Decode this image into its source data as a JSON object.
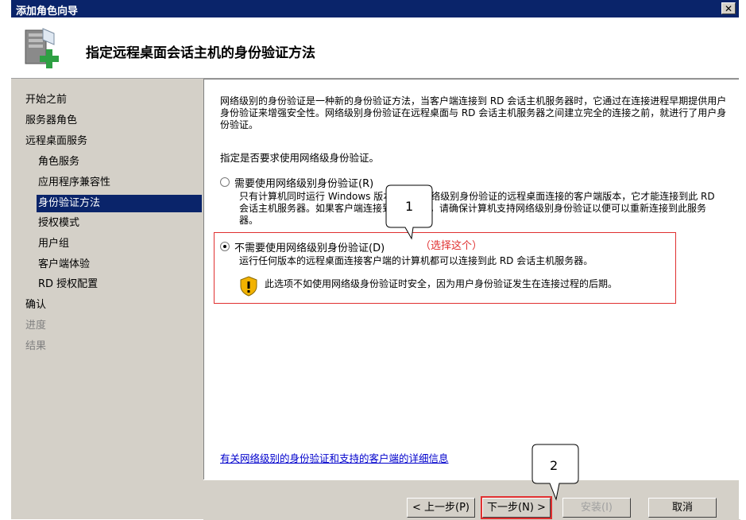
{
  "window": {
    "title": "添加角色向导",
    "close_glyph": "✕"
  },
  "header": {
    "title": "指定远程桌面会话主机的身份验证方法",
    "icon": "server-add-icon"
  },
  "nav": {
    "items": [
      {
        "label": "开始之前",
        "level": 0,
        "state": "normal"
      },
      {
        "label": "服务器角色",
        "level": 0,
        "state": "normal"
      },
      {
        "label": "远程桌面服务",
        "level": 0,
        "state": "normal"
      },
      {
        "label": "角色服务",
        "level": 1,
        "state": "normal"
      },
      {
        "label": "应用程序兼容性",
        "level": 1,
        "state": "normal"
      },
      {
        "label": "身份验证方法",
        "level": 1,
        "state": "active"
      },
      {
        "label": "授权模式",
        "level": 1,
        "state": "normal"
      },
      {
        "label": "用户组",
        "level": 1,
        "state": "normal"
      },
      {
        "label": "客户端体验",
        "level": 1,
        "state": "normal"
      },
      {
        "label": "RD 授权配置",
        "level": 1,
        "state": "normal"
      },
      {
        "label": "确认",
        "level": 0,
        "state": "normal"
      },
      {
        "label": "进度",
        "level": 0,
        "state": "disabled"
      },
      {
        "label": "结果",
        "level": 0,
        "state": "disabled"
      }
    ]
  },
  "content": {
    "description": "网络级别的身份验证是一种新的身份验证方法，当客户端连接到 RD 会话主机服务器时，它通过在连接进程早期提供用户身份验证来增强安全性。网络级别身份验证在远程桌面与 RD 会话主机服务器之间建立完全的连接之前，就进行了用户身份验证。",
    "prompt": "指定是否要求使用网络级身份验证。",
    "option_require": {
      "label": "需要使用网络级别身份验证(R)",
      "description": "只有计算机同时运行 Windows 版本和支持网络级别身份验证的远程桌面连接的客户端版本，它才能连接到此 RD 会话主机服务器。如果客户端连接到此服务器，请确保计算机支持网络级别身份验证以便可以重新连接到此服务器。",
      "selected": false
    },
    "option_no_require": {
      "label": "不需要使用网络级别身份验证(D)",
      "description": "运行任何版本的远程桌面连接客户端的计算机都可以连接到此 RD 会话主机服务器。",
      "warning": "此选项不如使用网络级身份验证时安全，因为用户身份验证发生在连接过程的后期。",
      "selected": true
    },
    "annotation": "（选择这个）",
    "link": "有关网络级别的身份验证和支持的客户端的详细信息"
  },
  "footer": {
    "prev": "< 上一步(P)",
    "next": "下一步(N) >",
    "install": "安装(I)",
    "cancel": "取消"
  },
  "callouts": {
    "one": "1",
    "two": "2"
  },
  "colors": {
    "selection": "#0a246a",
    "annotation": "#e03030",
    "link": "#0000cc"
  }
}
